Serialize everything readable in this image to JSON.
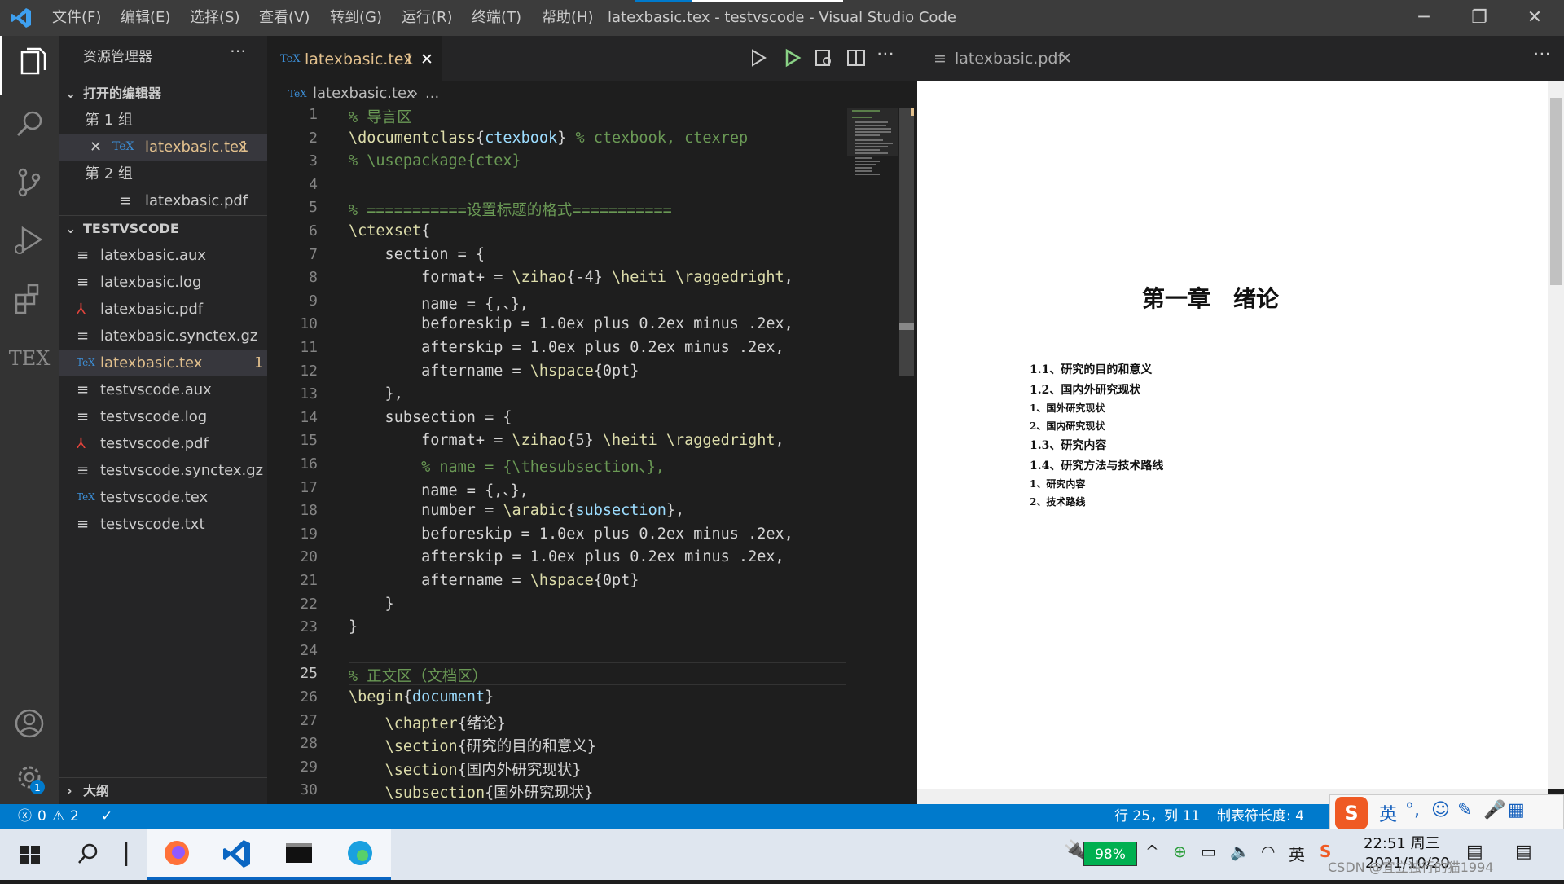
{
  "titlebar": {
    "title": "latexbasic.tex - testvscode - Visual Studio Code",
    "menus": [
      "文件(F)",
      "编辑(E)",
      "选择(S)",
      "查看(V)",
      "转到(G)",
      "运行(R)",
      "终端(T)",
      "帮助(H)"
    ]
  },
  "sidebar": {
    "header": "资源管理器",
    "open_editors_label": "打开的编辑器",
    "group1": "第 1 组",
    "group1_file": "latexbasic.tex",
    "group1_badge": "1",
    "group2": "第 2 组",
    "group2_file": "latexbasic.pdf",
    "workspace_label": "TESTVSCODE",
    "files": [
      {
        "name": "latexbasic.aux",
        "icon": "≡"
      },
      {
        "name": "latexbasic.log",
        "icon": "≡"
      },
      {
        "name": "latexbasic.pdf",
        "icon": "pdf"
      },
      {
        "name": "latexbasic.synctex.gz",
        "icon": "≡"
      },
      {
        "name": "latexbasic.tex",
        "icon": "tex",
        "badge": "1"
      },
      {
        "name": "testvscode.aux",
        "icon": "≡"
      },
      {
        "name": "testvscode.log",
        "icon": "≡"
      },
      {
        "name": "testvscode.pdf",
        "icon": "pdf"
      },
      {
        "name": "testvscode.synctex.gz",
        "icon": "≡"
      },
      {
        "name": "testvscode.tex",
        "icon": "tex"
      },
      {
        "name": "testvscode.txt",
        "icon": "≡"
      }
    ],
    "outline_label": "大纲"
  },
  "editor": {
    "tab_label": "latexbasic.tex",
    "tab_badge": "1",
    "breadcrumb_file": "latexbasic.tex",
    "breadcrumb_more": "...",
    "lines": [
      {
        "n": "1",
        "t": "% 导言区"
      },
      {
        "n": "2",
        "t": "\\documentclass{ctexbook} % ctexbook, ctexrep"
      },
      {
        "n": "3",
        "t": "% \\usepackage{ctex}"
      },
      {
        "n": "4",
        "t": ""
      },
      {
        "n": "5",
        "t": "% ===========设置标题的格式==========="
      },
      {
        "n": "6",
        "t": "\\ctexset{"
      },
      {
        "n": "7",
        "t": "    section = {"
      },
      {
        "n": "8",
        "t": "        format+ = \\zihao{-4} \\heiti \\raggedright,"
      },
      {
        "n": "9",
        "t": "        name = {,、},"
      },
      {
        "n": "10",
        "t": "        beforeskip = 1.0ex plus 0.2ex minus .2ex,"
      },
      {
        "n": "11",
        "t": "        afterskip = 1.0ex plus 0.2ex minus .2ex,"
      },
      {
        "n": "12",
        "t": "        aftername = \\hspace{0pt}"
      },
      {
        "n": "13",
        "t": "    },"
      },
      {
        "n": "14",
        "t": "    subsection = {"
      },
      {
        "n": "15",
        "t": "        format+ = \\zihao{5} \\heiti \\raggedright,"
      },
      {
        "n": "16",
        "t": "        % name = {\\thesubsection、},"
      },
      {
        "n": "17",
        "t": "        name = {,、},"
      },
      {
        "n": "18",
        "t": "        number = \\arabic{subsection},"
      },
      {
        "n": "19",
        "t": "        beforeskip = 1.0ex plus 0.2ex minus .2ex,"
      },
      {
        "n": "20",
        "t": "        afterskip = 1.0ex plus 0.2ex minus .2ex,"
      },
      {
        "n": "21",
        "t": "        aftername = \\hspace{0pt}"
      },
      {
        "n": "22",
        "t": "    }"
      },
      {
        "n": "23",
        "t": "}"
      },
      {
        "n": "24",
        "t": ""
      },
      {
        "n": "25",
        "t": "% 正文区（文档区）"
      },
      {
        "n": "26",
        "t": "\\begin{document}"
      },
      {
        "n": "27",
        "t": "    \\chapter{绪论}"
      },
      {
        "n": "28",
        "t": "    \\section{研究的目的和意义}"
      },
      {
        "n": "29",
        "t": "    \\section{国内外研究现状}"
      },
      {
        "n": "30",
        "t": "    \\subsection{国外研究现状}"
      }
    ]
  },
  "pdf": {
    "tab_label": "latexbasic.pdf",
    "chapter": "第一章　绪论",
    "toc": [
      {
        "t": "1.1、研究的目的和意义",
        "lvl": 1
      },
      {
        "t": "1.2、国内外研究现状",
        "lvl": 1
      },
      {
        "t": "1、国外研究现状",
        "lvl": 2
      },
      {
        "t": "2、国内研究现状",
        "lvl": 2
      },
      {
        "t": "1.3、研究内容",
        "lvl": 1
      },
      {
        "t": "1.4、研究方法与技术路线",
        "lvl": 1
      },
      {
        "t": "1、研究内容",
        "lvl": 2
      },
      {
        "t": "2、技术路线",
        "lvl": 2
      }
    ]
  },
  "status": {
    "errors": "0",
    "warnings": "2",
    "position": "行 25，列 11",
    "tabsize": "制表符长度: 4"
  },
  "taskbar": {
    "battery": "98%",
    "time": "22:51 周三",
    "date": "2021/10/20",
    "ime": "英",
    "lang": "英",
    "watermark": "CSDN @宜立独行的猫1994"
  },
  "colors": {
    "accent": "#007acc",
    "modified": "#e2c08d",
    "comment": "#6a9955"
  }
}
